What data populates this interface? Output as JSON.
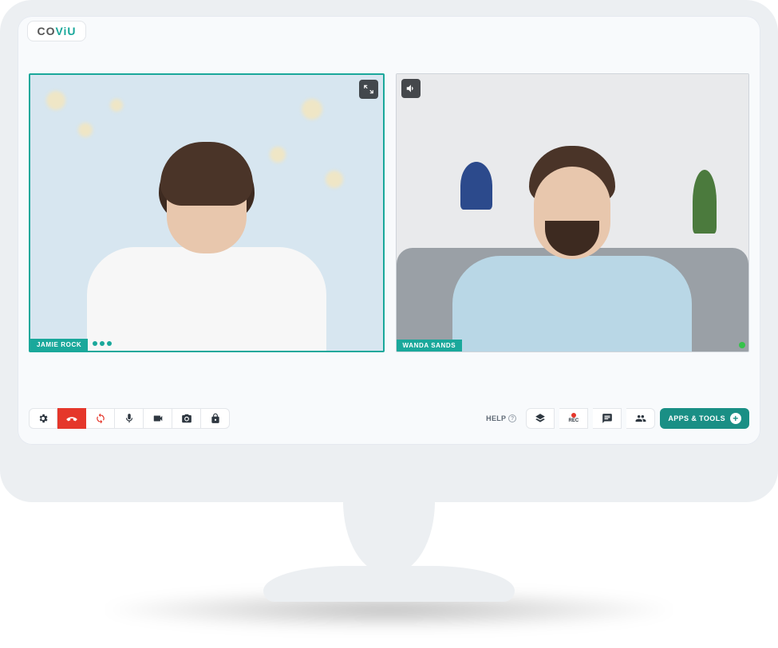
{
  "brand": {
    "text_prefix": "CO",
    "text_accent": "ViU"
  },
  "participants": {
    "left": {
      "name": "JAMIE ROCK",
      "active": true
    },
    "right": {
      "name": "WANDA SANDS",
      "active": false
    }
  },
  "icons": {
    "shrink": "shrink-icon",
    "speaker": "speaker-icon"
  },
  "toolbar": {
    "left": {
      "settings": {
        "icon": "gear-icon"
      },
      "hangup": {
        "icon": "phone-down-icon"
      },
      "sync": {
        "icon": "sync-icon"
      },
      "mic": {
        "icon": "mic-icon"
      },
      "video": {
        "icon": "video-icon"
      },
      "camera": {
        "icon": "camera-icon"
      },
      "lock": {
        "icon": "lock-icon"
      }
    },
    "right": {
      "help_label": "HELP",
      "layers": {
        "icon": "layers-icon"
      },
      "record": {
        "label": "REC"
      },
      "chat": {
        "icon": "chat-icon"
      },
      "people": {
        "icon": "people-icon"
      },
      "apps": {
        "label": "APPS & TOOLS"
      }
    }
  }
}
